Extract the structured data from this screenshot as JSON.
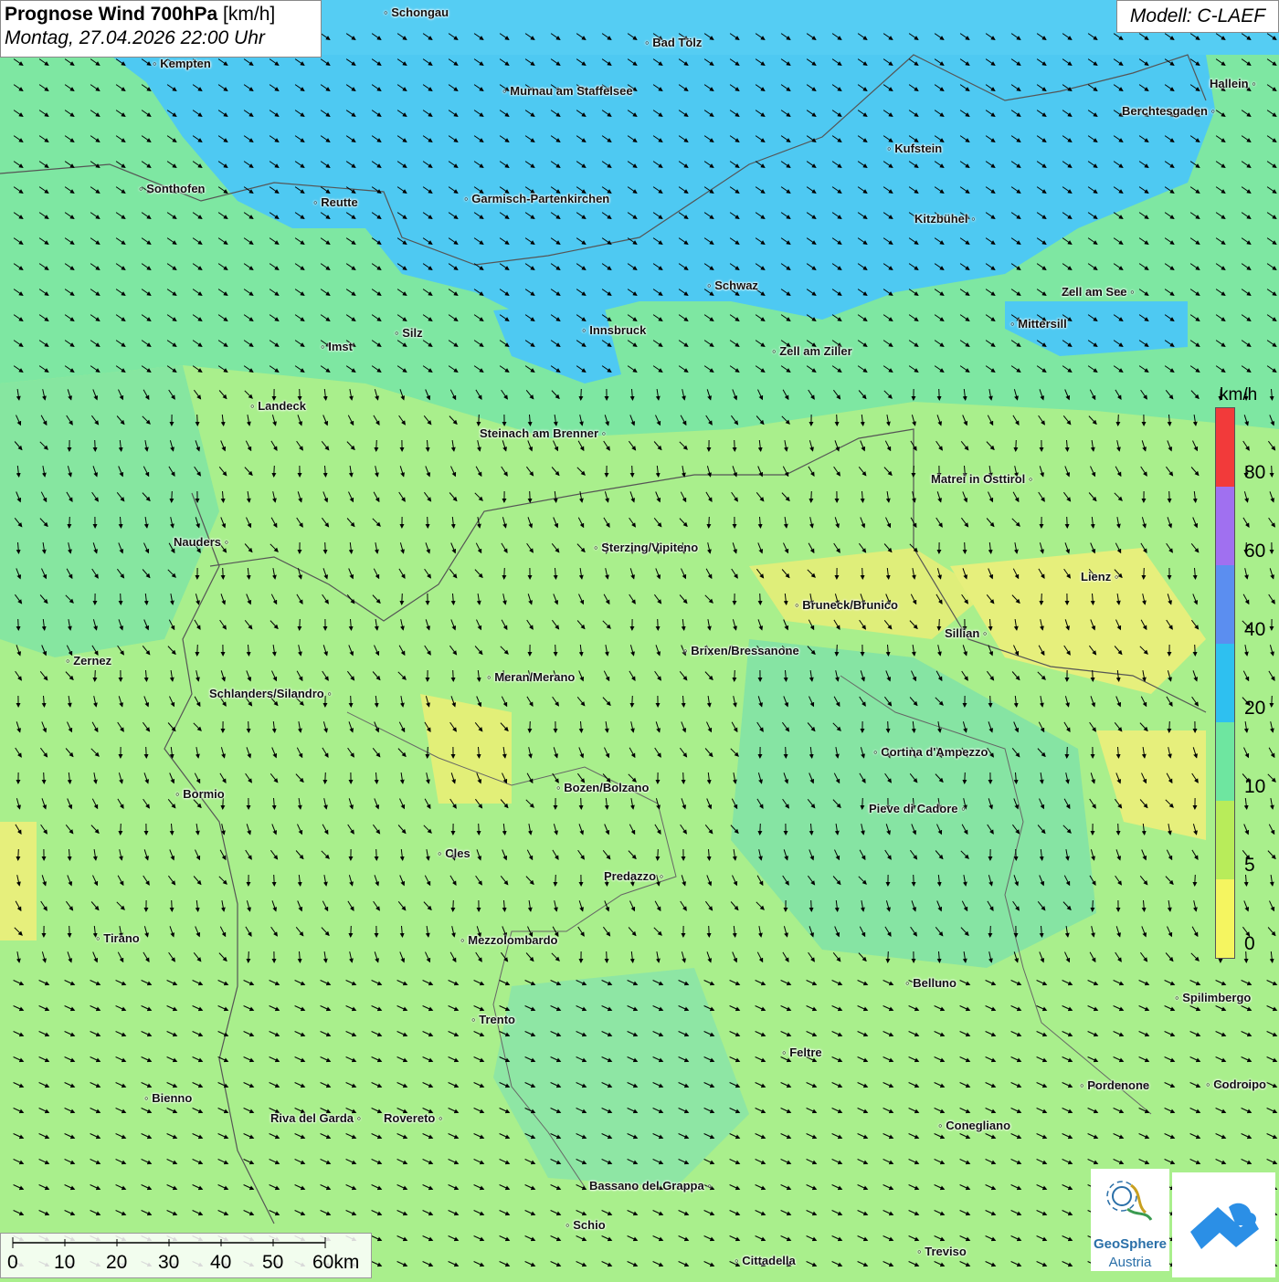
{
  "title": {
    "main": "Prognose Wind 700hPa",
    "unit": "[km/h]",
    "datetime": "Montag, 27.04.2026 22:00 Uhr"
  },
  "model": "Modell: C-LAEF",
  "legend": {
    "unit": "km/h",
    "labels": [
      "80",
      "60",
      "40",
      "20",
      "10",
      "5",
      "0"
    ],
    "colors": [
      "#f23a3a",
      "#a070f0",
      "#5b8ef0",
      "#2ec0f0",
      "#6ee6a0",
      "#b8ec5a",
      "#f5f560"
    ]
  },
  "scalebar": {
    "labels": [
      "0",
      "10",
      "20",
      "30",
      "40",
      "50",
      "60km"
    ]
  },
  "logo": {
    "text1": "GeoSphere",
    "text2": "Austria"
  },
  "cities": [
    {
      "name": "Schongau"
    },
    {
      "name": "Bad Tölz"
    },
    {
      "name": "Kempten"
    },
    {
      "name": "Murnau am Staffelsee"
    },
    {
      "name": "Hallein"
    },
    {
      "name": "Berchtesgaden"
    },
    {
      "name": "Kufstein"
    },
    {
      "name": "Sonthofen"
    },
    {
      "name": "Reutte"
    },
    {
      "name": "Garmisch-Partenkirchen"
    },
    {
      "name": "Kitzbühel"
    },
    {
      "name": "Schwaz"
    },
    {
      "name": "Zell am See"
    },
    {
      "name": "Innsbruck"
    },
    {
      "name": "Mittersill"
    },
    {
      "name": "Silz"
    },
    {
      "name": "Imst"
    },
    {
      "name": "Zell am Ziller"
    },
    {
      "name": "Landeck"
    },
    {
      "name": "Steinach am Brenner"
    },
    {
      "name": "Matrei in Osttirol"
    },
    {
      "name": "Nauders"
    },
    {
      "name": "Sterzing/Vipiteno"
    },
    {
      "name": "Lienz"
    },
    {
      "name": "Bruneck/Brunico"
    },
    {
      "name": "Sillian"
    },
    {
      "name": "Zernez"
    },
    {
      "name": "Brixen/Bressanone"
    },
    {
      "name": "Meran/Merano"
    },
    {
      "name": "Schlanders/Silandro"
    },
    {
      "name": "Cortina d'Ampezzo"
    },
    {
      "name": "Bozen/Bolzano"
    },
    {
      "name": "Bormio"
    },
    {
      "name": "Pieve di Cadore"
    },
    {
      "name": "Cles"
    },
    {
      "name": "Predazzo"
    },
    {
      "name": "Tirano"
    },
    {
      "name": "Mezzolombardo"
    },
    {
      "name": "Belluno"
    },
    {
      "name": "Spilimbergo"
    },
    {
      "name": "Trento"
    },
    {
      "name": "Feltre"
    },
    {
      "name": "Pordenone"
    },
    {
      "name": "Codroipo"
    },
    {
      "name": "Bienno"
    },
    {
      "name": "Riva del Garda"
    },
    {
      "name": "Rovereto"
    },
    {
      "name": "Conegliano"
    },
    {
      "name": "Bassano del Grappa"
    },
    {
      "name": "Schio"
    },
    {
      "name": "Treviso"
    },
    {
      "name": "Cittadella"
    }
  ]
}
